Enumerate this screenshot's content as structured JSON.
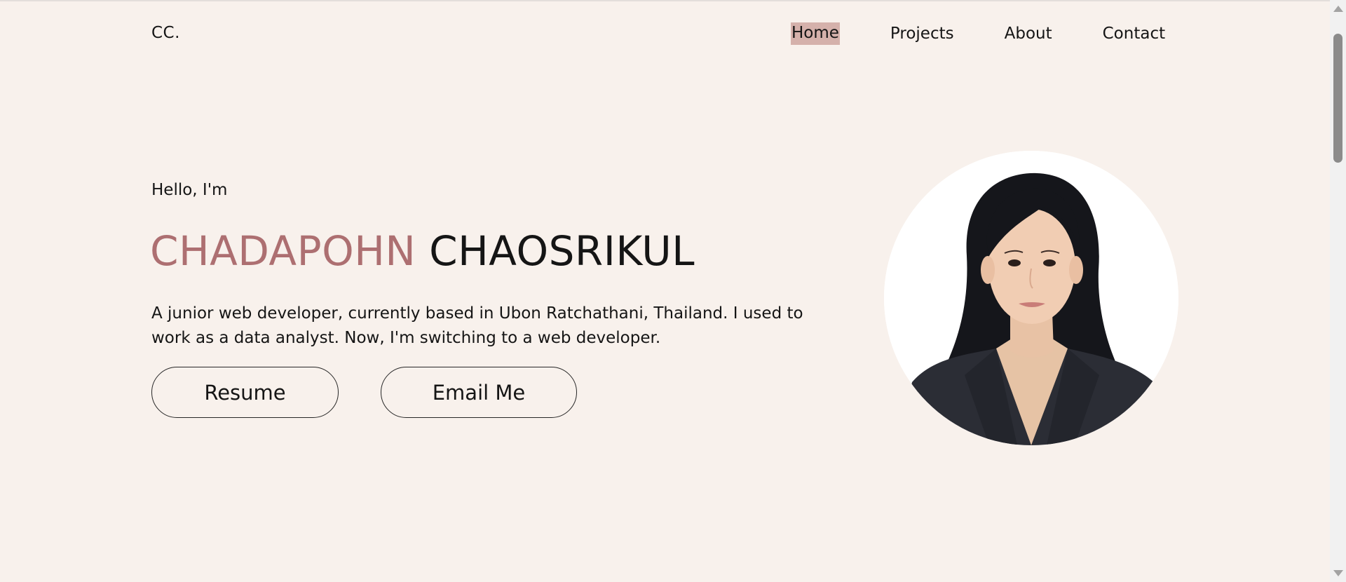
{
  "header": {
    "logo": "CC.",
    "nav": [
      {
        "label": "Home",
        "active": true
      },
      {
        "label": "Projects"
      },
      {
        "label": "About"
      },
      {
        "label": "Contact"
      }
    ]
  },
  "hero": {
    "greeting": "Hello, I'm",
    "first_name": "CHADAPOHN",
    "last_name": "CHAOSRIKUL",
    "bio": "A junior web developer, currently based in Ubon Ratchathani, Thailand. I used to work as a data analyst. Now, I'm switching to a web developer.",
    "buttons": {
      "resume": "Resume",
      "email": "Email Me"
    }
  },
  "colors": {
    "background": "#f8f1ec",
    "accent": "#ad6f71",
    "nav_highlight": "#d5b1ab",
    "text": "#151515"
  }
}
